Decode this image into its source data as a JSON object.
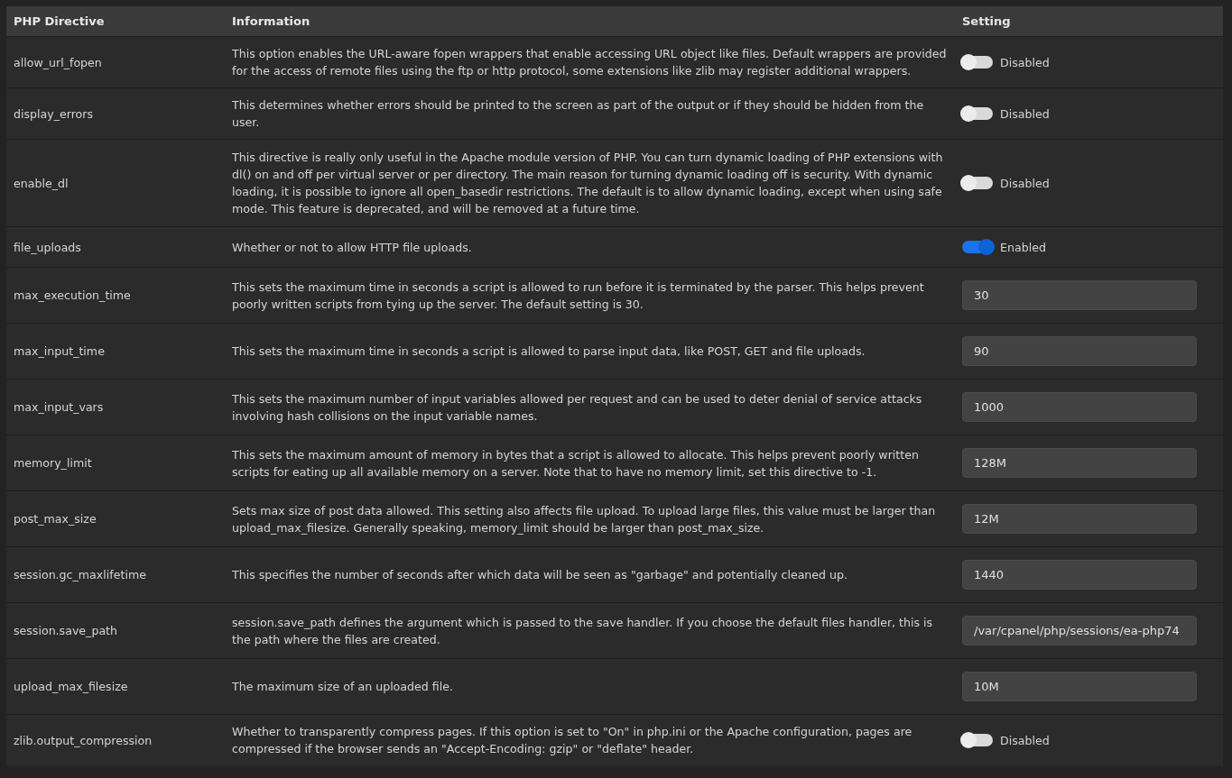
{
  "table": {
    "columns": [
      "PHP Directive",
      "Information",
      "Setting"
    ],
    "rows": [
      {
        "directive": "allow_url_fopen",
        "info": "This option enables the URL-aware fopen wrappers that enable accessing URL object like files. Default wrappers are provided for the access of remote files using the ftp or http protocol, some extensions like zlib may register additional wrappers.",
        "setting": {
          "kind": "toggle",
          "on": false,
          "label": "Disabled"
        }
      },
      {
        "directive": "display_errors",
        "info": "This determines whether errors should be printed to the screen as part of the output or if they should be hidden from the user.",
        "setting": {
          "kind": "toggle",
          "on": false,
          "label": "Disabled"
        }
      },
      {
        "directive": "enable_dl",
        "info": "This directive is really only useful in the Apache module version of PHP. You can turn dynamic loading of PHP extensions with dl() on and off per virtual server or per directory. The main reason for turning dynamic loading off is security. With dynamic loading, it is possible to ignore all open_basedir restrictions. The default is to allow dynamic loading, except when using safe mode. This feature is deprecated, and will be removed at a future time.",
        "setting": {
          "kind": "toggle",
          "on": false,
          "label": "Disabled"
        }
      },
      {
        "directive": "file_uploads",
        "info": "Whether or not to allow HTTP file uploads.",
        "setting": {
          "kind": "toggle",
          "on": true,
          "label": "Enabled"
        }
      },
      {
        "directive": "max_execution_time",
        "info": "This sets the maximum time in seconds a script is allowed to run before it is terminated by the parser. This helps prevent poorly written scripts from tying up the server. The default setting is 30.",
        "setting": {
          "kind": "input",
          "value": "30"
        }
      },
      {
        "directive": "max_input_time",
        "info": "This sets the maximum time in seconds a script is allowed to parse input data, like POST, GET and file uploads.",
        "setting": {
          "kind": "input",
          "value": "90"
        }
      },
      {
        "directive": "max_input_vars",
        "info": "This sets the maximum number of input variables allowed per request and can be used to deter denial of service attacks involving hash collisions on the input variable names.",
        "setting": {
          "kind": "input",
          "value": "1000"
        }
      },
      {
        "directive": "memory_limit",
        "info": "This sets the maximum amount of memory in bytes that a script is allowed to allocate. This helps prevent poorly written scripts for eating up all available memory on a server. Note that to have no memory limit, set this directive to -1.",
        "setting": {
          "kind": "input",
          "value": "128M"
        }
      },
      {
        "directive": "post_max_size",
        "info": "Sets max size of post data allowed. This setting also affects file upload. To upload large files, this value must be larger than upload_max_filesize. Generally speaking, memory_limit should be larger than post_max_size.",
        "setting": {
          "kind": "input",
          "value": "12M"
        }
      },
      {
        "directive": "session.gc_maxlifetime",
        "info": "This specifies the number of seconds after which data will be seen as \"garbage\" and potentially cleaned up.",
        "setting": {
          "kind": "input",
          "value": "1440"
        }
      },
      {
        "directive": "session.save_path",
        "info": "session.save_path defines the argument which is passed to the save handler. If you choose the default files handler, this is the path where the files are created.",
        "setting": {
          "kind": "input",
          "value": "/var/cpanel/php/sessions/ea-php74"
        }
      },
      {
        "directive": "upload_max_filesize",
        "info": "The maximum size of an uploaded file.",
        "setting": {
          "kind": "input",
          "value": "10M"
        }
      },
      {
        "directive": "zlib.output_compression",
        "info": "Whether to transparently compress pages. If this option is set to \"On\" in php.ini or the Apache configuration, pages are compressed if the browser sends an \"Accept-Encoding: gzip\" or \"deflate\" header.",
        "setting": {
          "kind": "toggle",
          "on": false,
          "label": "Disabled"
        }
      }
    ]
  }
}
